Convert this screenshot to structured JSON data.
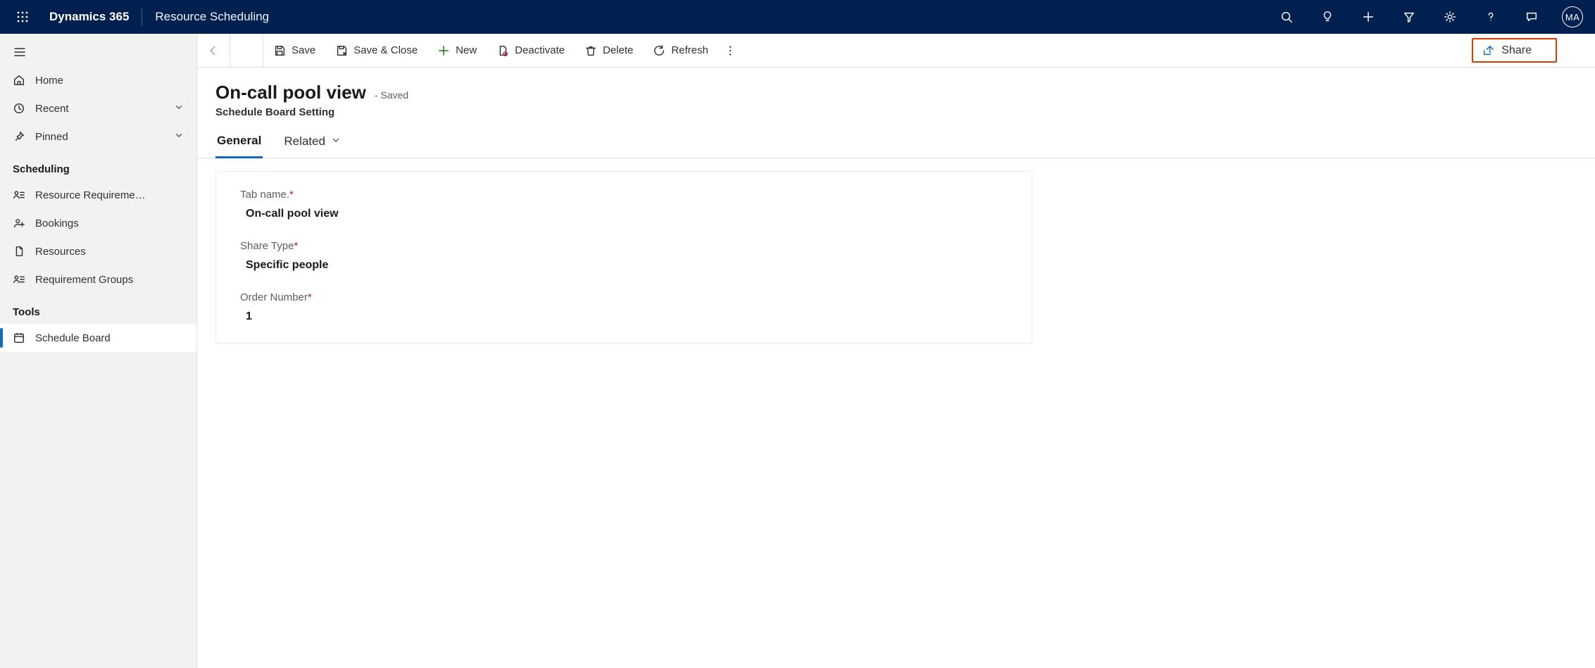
{
  "titlebar": {
    "brand": "Dynamics 365",
    "area": "Resource Scheduling",
    "avatar_initials": "MA"
  },
  "leftnav": {
    "top": [
      {
        "key": "home",
        "label": "Home",
        "icon": "home",
        "expandable": false
      },
      {
        "key": "recent",
        "label": "Recent",
        "icon": "clock",
        "expandable": true
      },
      {
        "key": "pinned",
        "label": "Pinned",
        "icon": "pin",
        "expandable": true
      }
    ],
    "sections": [
      {
        "title": "Scheduling",
        "items": [
          {
            "key": "req",
            "label": "Resource Requireme…",
            "icon": "people-list"
          },
          {
            "key": "book",
            "label": "Bookings",
            "icon": "person-plus"
          },
          {
            "key": "res",
            "label": "Resources",
            "icon": "file"
          },
          {
            "key": "reqgrp",
            "label": "Requirement Groups",
            "icon": "people-list"
          }
        ]
      },
      {
        "title": "Tools",
        "items": [
          {
            "key": "schedboard",
            "label": "Schedule Board",
            "icon": "calendar",
            "selected": true
          }
        ]
      }
    ]
  },
  "commandbar": {
    "save": "Save",
    "save_close": "Save & Close",
    "new": "New",
    "deactivate": "Deactivate",
    "delete": "Delete",
    "refresh": "Refresh",
    "share": "Share"
  },
  "page": {
    "title": "On-call pool view",
    "status": "- Saved",
    "subtitle": "Schedule Board Setting",
    "tabs": {
      "general": "General",
      "related": "Related"
    },
    "fields": {
      "tab_name": {
        "label": "Tab name.",
        "value": "On-call pool view"
      },
      "share_type": {
        "label": "Share Type",
        "value": "Specific people"
      },
      "order_number": {
        "label": "Order Number",
        "value": "1"
      }
    }
  },
  "icons": {
    "search": "search-icon",
    "idea": "lightbulb-icon",
    "add": "plus-icon",
    "filter": "funnel-icon",
    "settings": "gear-icon",
    "help": "question-icon",
    "chat": "chat-icon",
    "popout": "popout-icon",
    "back": "back-icon",
    "more": "more-vertical-icon"
  }
}
